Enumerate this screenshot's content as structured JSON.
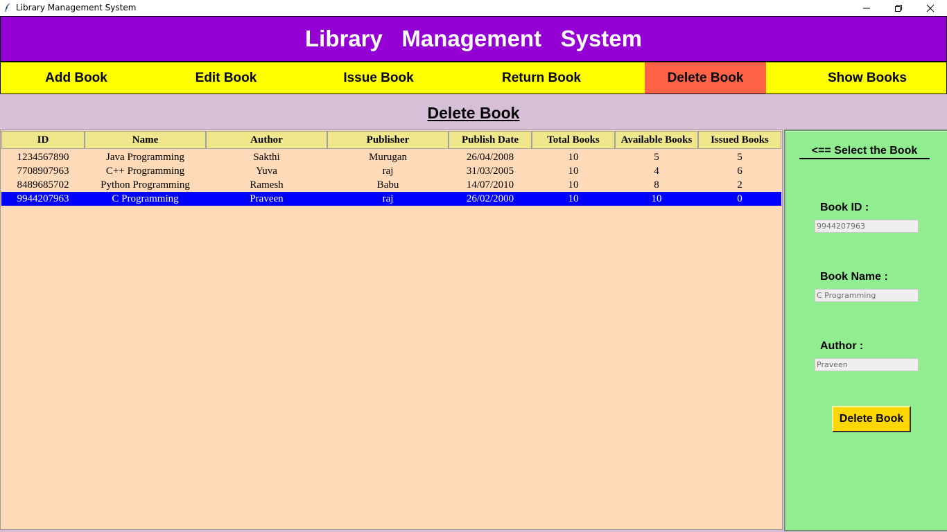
{
  "window": {
    "title": "Library Management System",
    "icons": [
      "feather-icon",
      "minimize-icon",
      "restore-icon",
      "close-icon"
    ]
  },
  "header": {
    "title": "Library   Management   System"
  },
  "nav": {
    "items": [
      {
        "label": "Add Book"
      },
      {
        "label": "Edit Book"
      },
      {
        "label": "Issue Book"
      },
      {
        "label": "Return Book"
      },
      {
        "label": "Delete Book",
        "active": true
      },
      {
        "label": "Show Books"
      }
    ]
  },
  "page": {
    "title": "Delete Book"
  },
  "table": {
    "columns": [
      "ID",
      "Name",
      "Author",
      "Publisher",
      "Publish Date",
      "Total Books",
      "Available Books",
      "Issued Books"
    ],
    "rows": [
      [
        "1234567890",
        "Java Programming",
        "Sakthi",
        "Murugan",
        "26/04/2008",
        "10",
        "5",
        "5"
      ],
      [
        "7708907963",
        "C++ Programming",
        "Yuva",
        "raj",
        "31/03/2005",
        "10",
        "4",
        "6"
      ],
      [
        "8489685702",
        "Python Programming",
        "Ramesh",
        "Babu",
        "14/07/2010",
        "10",
        "8",
        "2"
      ],
      [
        "9944207963",
        "C Programming",
        "Praveen",
        "raj",
        "26/02/2000",
        "10",
        "10",
        "0"
      ]
    ],
    "selected_row": 3
  },
  "side": {
    "title": "<== Select the Book",
    "book_id_label": "Book ID :",
    "book_id_value": "9944207963",
    "book_name_label": "Book Name :",
    "book_name_value": "C Programming",
    "author_label": "Author :",
    "author_value": "Praveen",
    "delete_label": "Delete Book"
  },
  "colors": {
    "header_bg": "#9400d3",
    "nav_bg": "#ffff00",
    "nav_active_bg": "#ff6347",
    "content_bg": "#d8bfd8",
    "table_bg": "#ffdab9",
    "table_header_bg": "#f0e68c",
    "selected_row_bg": "#0000ff",
    "side_bg": "#90ee90",
    "button_bg": "#ffd700"
  }
}
